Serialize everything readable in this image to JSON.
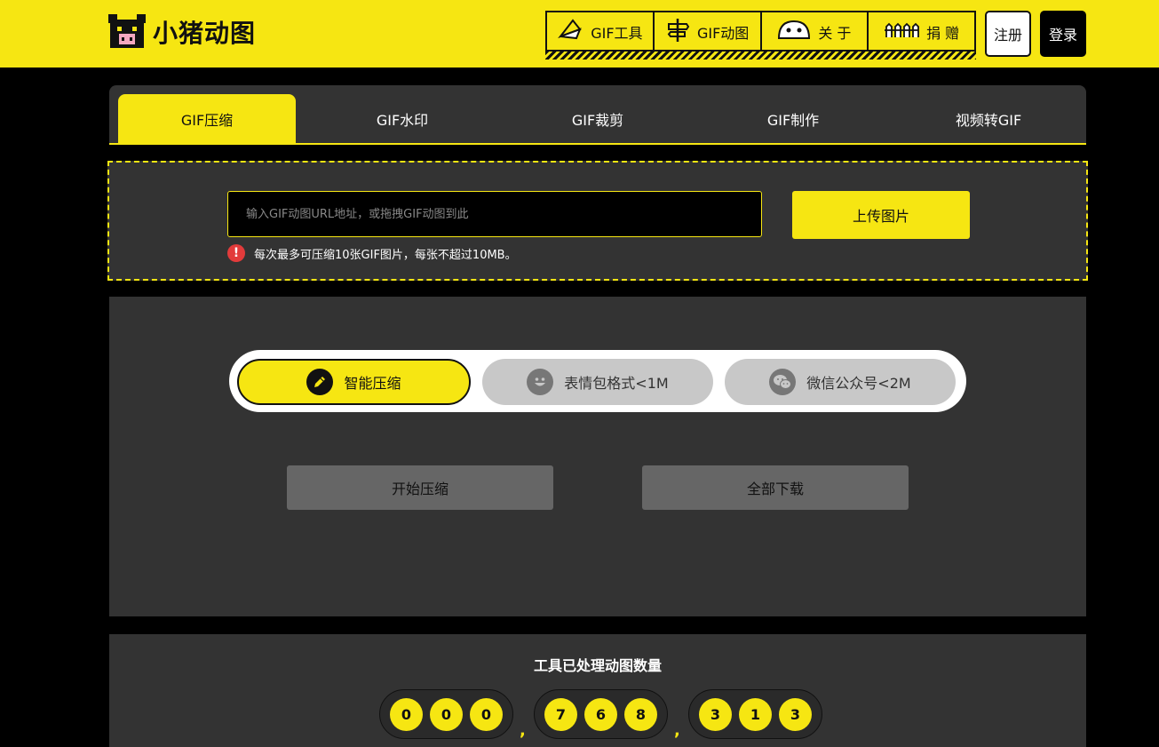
{
  "header": {
    "logo_text": "小猪动图",
    "nav": [
      {
        "label": "GIF工具",
        "icon": "fan-icon"
      },
      {
        "label": "GIF动图",
        "icon": "signpost-icon"
      },
      {
        "label": "关 于",
        "icon": "face-icon"
      },
      {
        "label": "捐 赠",
        "icon": "fence-icon"
      }
    ],
    "register_label": "注册",
    "login_label": "登录"
  },
  "tabs": [
    {
      "label": "GIF压缩",
      "active": true
    },
    {
      "label": "GIF水印",
      "active": false
    },
    {
      "label": "GIF裁剪",
      "active": false
    },
    {
      "label": "GIF制作",
      "active": false
    },
    {
      "label": "视频转GIF",
      "active": false
    }
  ],
  "upload": {
    "placeholder": "输入GIF动图URL地址，或拖拽GIF动图到此",
    "button_label": "上传图片",
    "notice": "每次最多可压缩10张GIF图片，每张不超过10MB。"
  },
  "modes": [
    {
      "label": "智能压缩",
      "icon": "pencil-icon",
      "active": true
    },
    {
      "label": "表情包格式<1M",
      "icon": "smiley-icon",
      "active": false
    },
    {
      "label": "微信公众号<2M",
      "icon": "wechat-icon",
      "active": false
    }
  ],
  "actions": {
    "start_label": "开始压缩",
    "download_label": "全部下载"
  },
  "stats": {
    "title": "工具已处理动图数量",
    "groups": [
      [
        "0",
        "0",
        "0"
      ],
      [
        "7",
        "6",
        "8"
      ],
      [
        "3",
        "1",
        "3"
      ]
    ],
    "separator": ","
  },
  "colors": {
    "accent": "#f6e612",
    "panel": "#333333",
    "background": "#000000",
    "alert": "#e23b3b"
  }
}
